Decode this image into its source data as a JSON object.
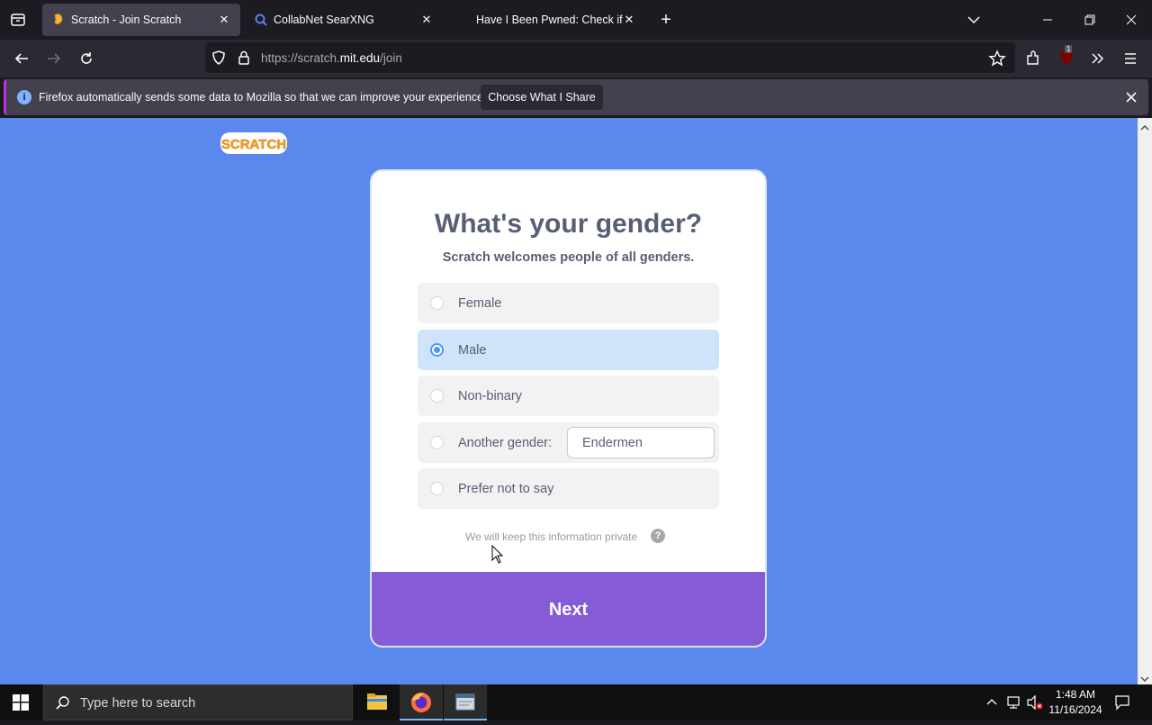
{
  "browser": {
    "tabs": [
      {
        "label": "Scratch - Join Scratch",
        "active": true
      },
      {
        "label": "CollabNet SearXNG",
        "active": false
      },
      {
        "label": "Have I Been Pwned: Check if yo",
        "active": false
      }
    ],
    "url": "https://scratch.mit.edu/join",
    "url_parts": {
      "prefix": "https://scratch.",
      "domain": "mit.edu",
      "path": "/join"
    },
    "extension_badge": "1",
    "notification": {
      "text": "Firefox automatically sends some data to Mozilla so that we can improve your experience.",
      "button": "Choose What I Share"
    }
  },
  "page": {
    "logo_text": "SCRATCH",
    "title": "What's your gender?",
    "subtitle": "Scratch welcomes people of all genders.",
    "options": [
      {
        "label": "Female",
        "selected": false
      },
      {
        "label": "Male",
        "selected": true
      },
      {
        "label": "Non-binary",
        "selected": false
      },
      {
        "label": "Another gender:",
        "selected": false,
        "input_value": "Endermen"
      },
      {
        "label": "Prefer not to say",
        "selected": false
      }
    ],
    "privacy_note": "We will keep this information private",
    "help_glyph": "?",
    "next_button": "Next"
  },
  "taskbar": {
    "search_placeholder": "Type here to search",
    "time": "1:48 AM",
    "date": "11/16/2024"
  },
  "colors": {
    "page_background": "#5b88ed",
    "next_button": "#855cd6",
    "selected_option": "#cfe4fb",
    "radio_accent": "#4d97ff",
    "browser_chrome": "#1c1b22"
  }
}
